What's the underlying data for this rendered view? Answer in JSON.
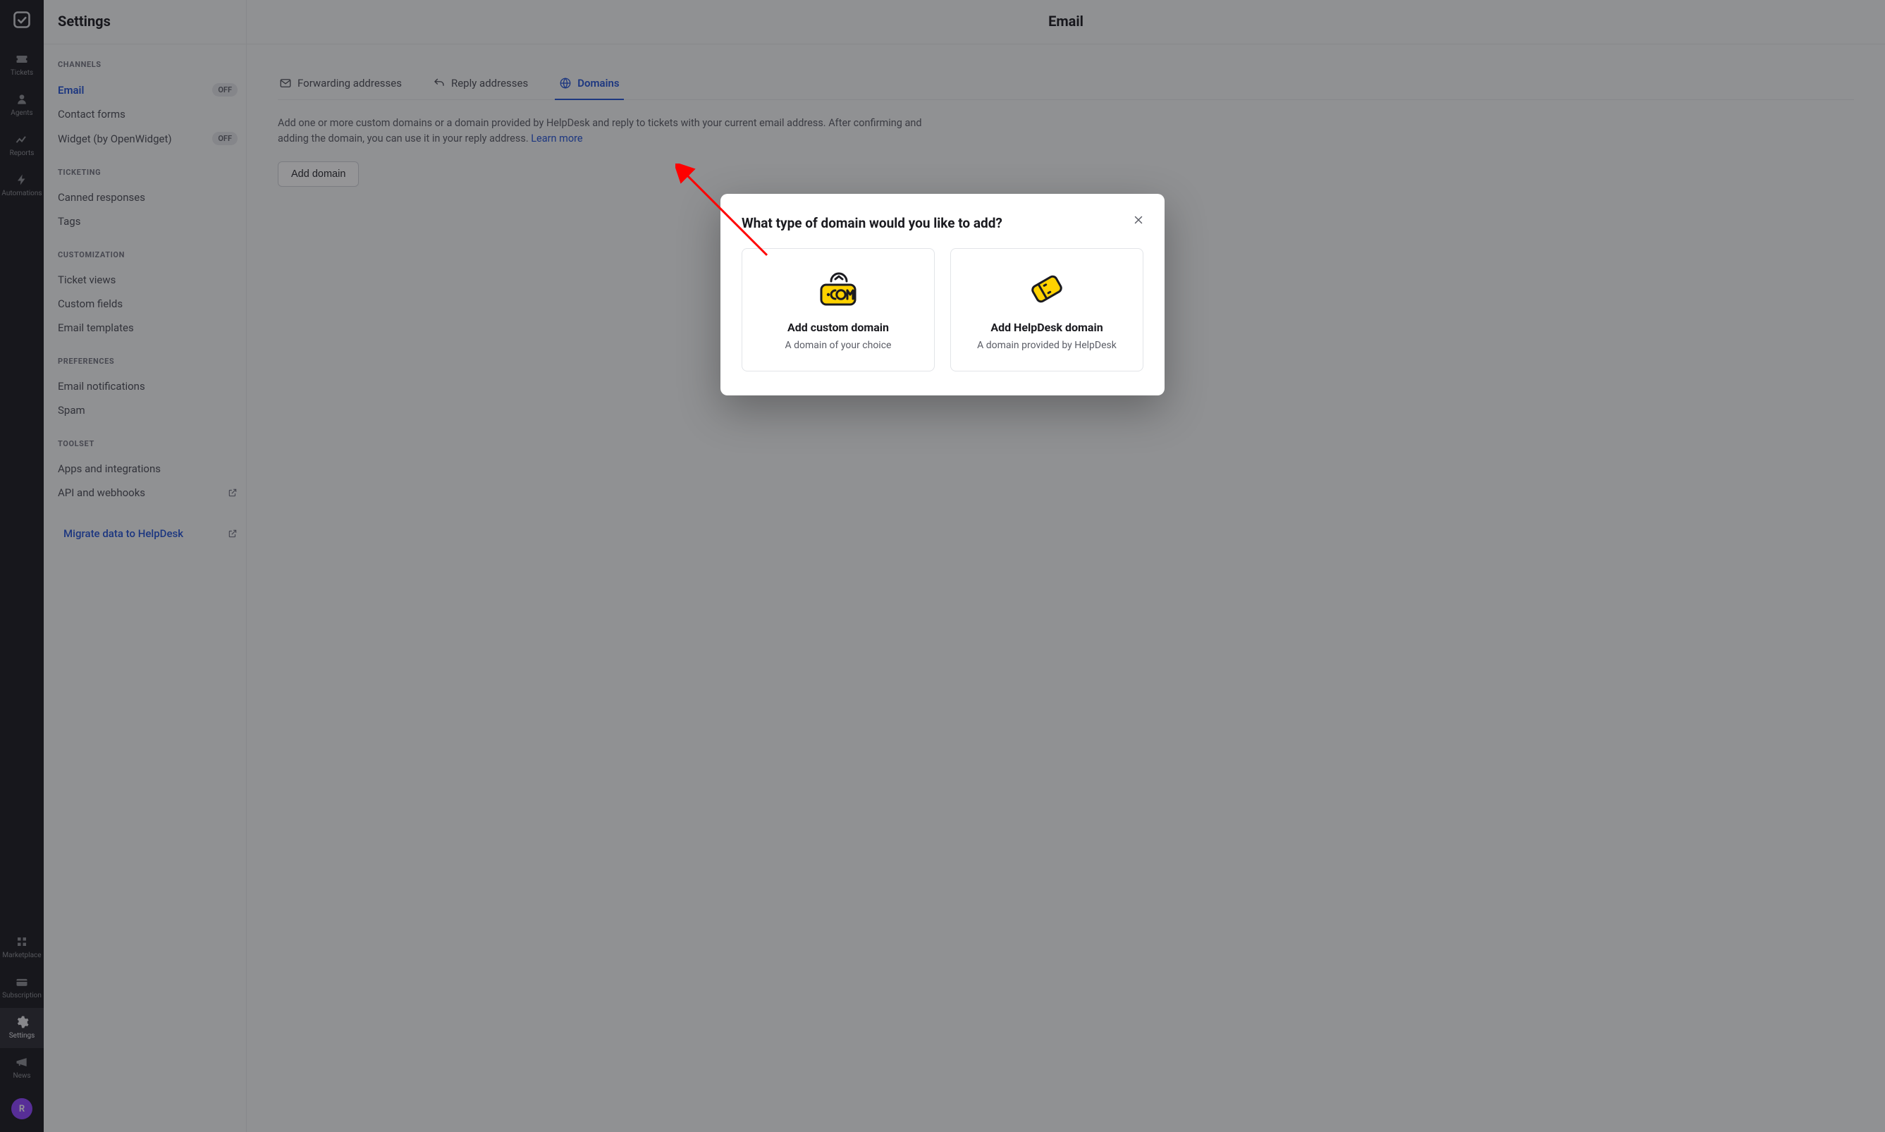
{
  "rail": {
    "items_top": [
      {
        "id": "tickets",
        "label": "Tickets"
      },
      {
        "id": "agents",
        "label": "Agents"
      },
      {
        "id": "reports",
        "label": "Reports"
      },
      {
        "id": "automations",
        "label": "Automations"
      }
    ],
    "items_bottom": [
      {
        "id": "marketplace",
        "label": "Marketplace"
      },
      {
        "id": "subscription",
        "label": "Subscription"
      },
      {
        "id": "settings",
        "label": "Settings"
      },
      {
        "id": "news",
        "label": "News"
      }
    ],
    "avatar_letter": "R"
  },
  "sidebar": {
    "title": "Settings",
    "groups": [
      {
        "label": "CHANNELS",
        "items": [
          {
            "label": "Email",
            "active": true,
            "badge": "OFF"
          },
          {
            "label": "Contact forms"
          },
          {
            "label": "Widget (by OpenWidget)",
            "badge": "OFF"
          }
        ]
      },
      {
        "label": "TICKETING",
        "items": [
          {
            "label": "Canned responses"
          },
          {
            "label": "Tags"
          }
        ]
      },
      {
        "label": "CUSTOMIZATION",
        "items": [
          {
            "label": "Ticket views"
          },
          {
            "label": "Custom fields"
          },
          {
            "label": "Email templates"
          }
        ]
      },
      {
        "label": "PREFERENCES",
        "items": [
          {
            "label": "Email notifications"
          },
          {
            "label": "Spam"
          }
        ]
      },
      {
        "label": "TOOLSET",
        "items": [
          {
            "label": "Apps and integrations"
          },
          {
            "label": "API and webhooks",
            "external": true
          }
        ]
      }
    ],
    "migrate": "Migrate data to HelpDesk"
  },
  "main": {
    "title": "Email",
    "tabs": [
      {
        "id": "forwarding",
        "label": "Forwarding addresses"
      },
      {
        "id": "reply",
        "label": "Reply addresses"
      },
      {
        "id": "domains",
        "label": "Domains",
        "active": true
      }
    ],
    "description": "Add one or more custom domains or a domain provided by HelpDesk and reply to tickets with your current email address. After confirming and adding the domain, you can use it in your reply address. ",
    "learn_more": "Learn more",
    "add_domain_btn": "Add domain"
  },
  "modal": {
    "title": "What type of domain would you like to add?",
    "options": [
      {
        "title": "Add custom domain",
        "sub": "A domain of your choice"
      },
      {
        "title": "Add HelpDesk domain",
        "sub": "A domain provided by HelpDesk"
      }
    ]
  }
}
